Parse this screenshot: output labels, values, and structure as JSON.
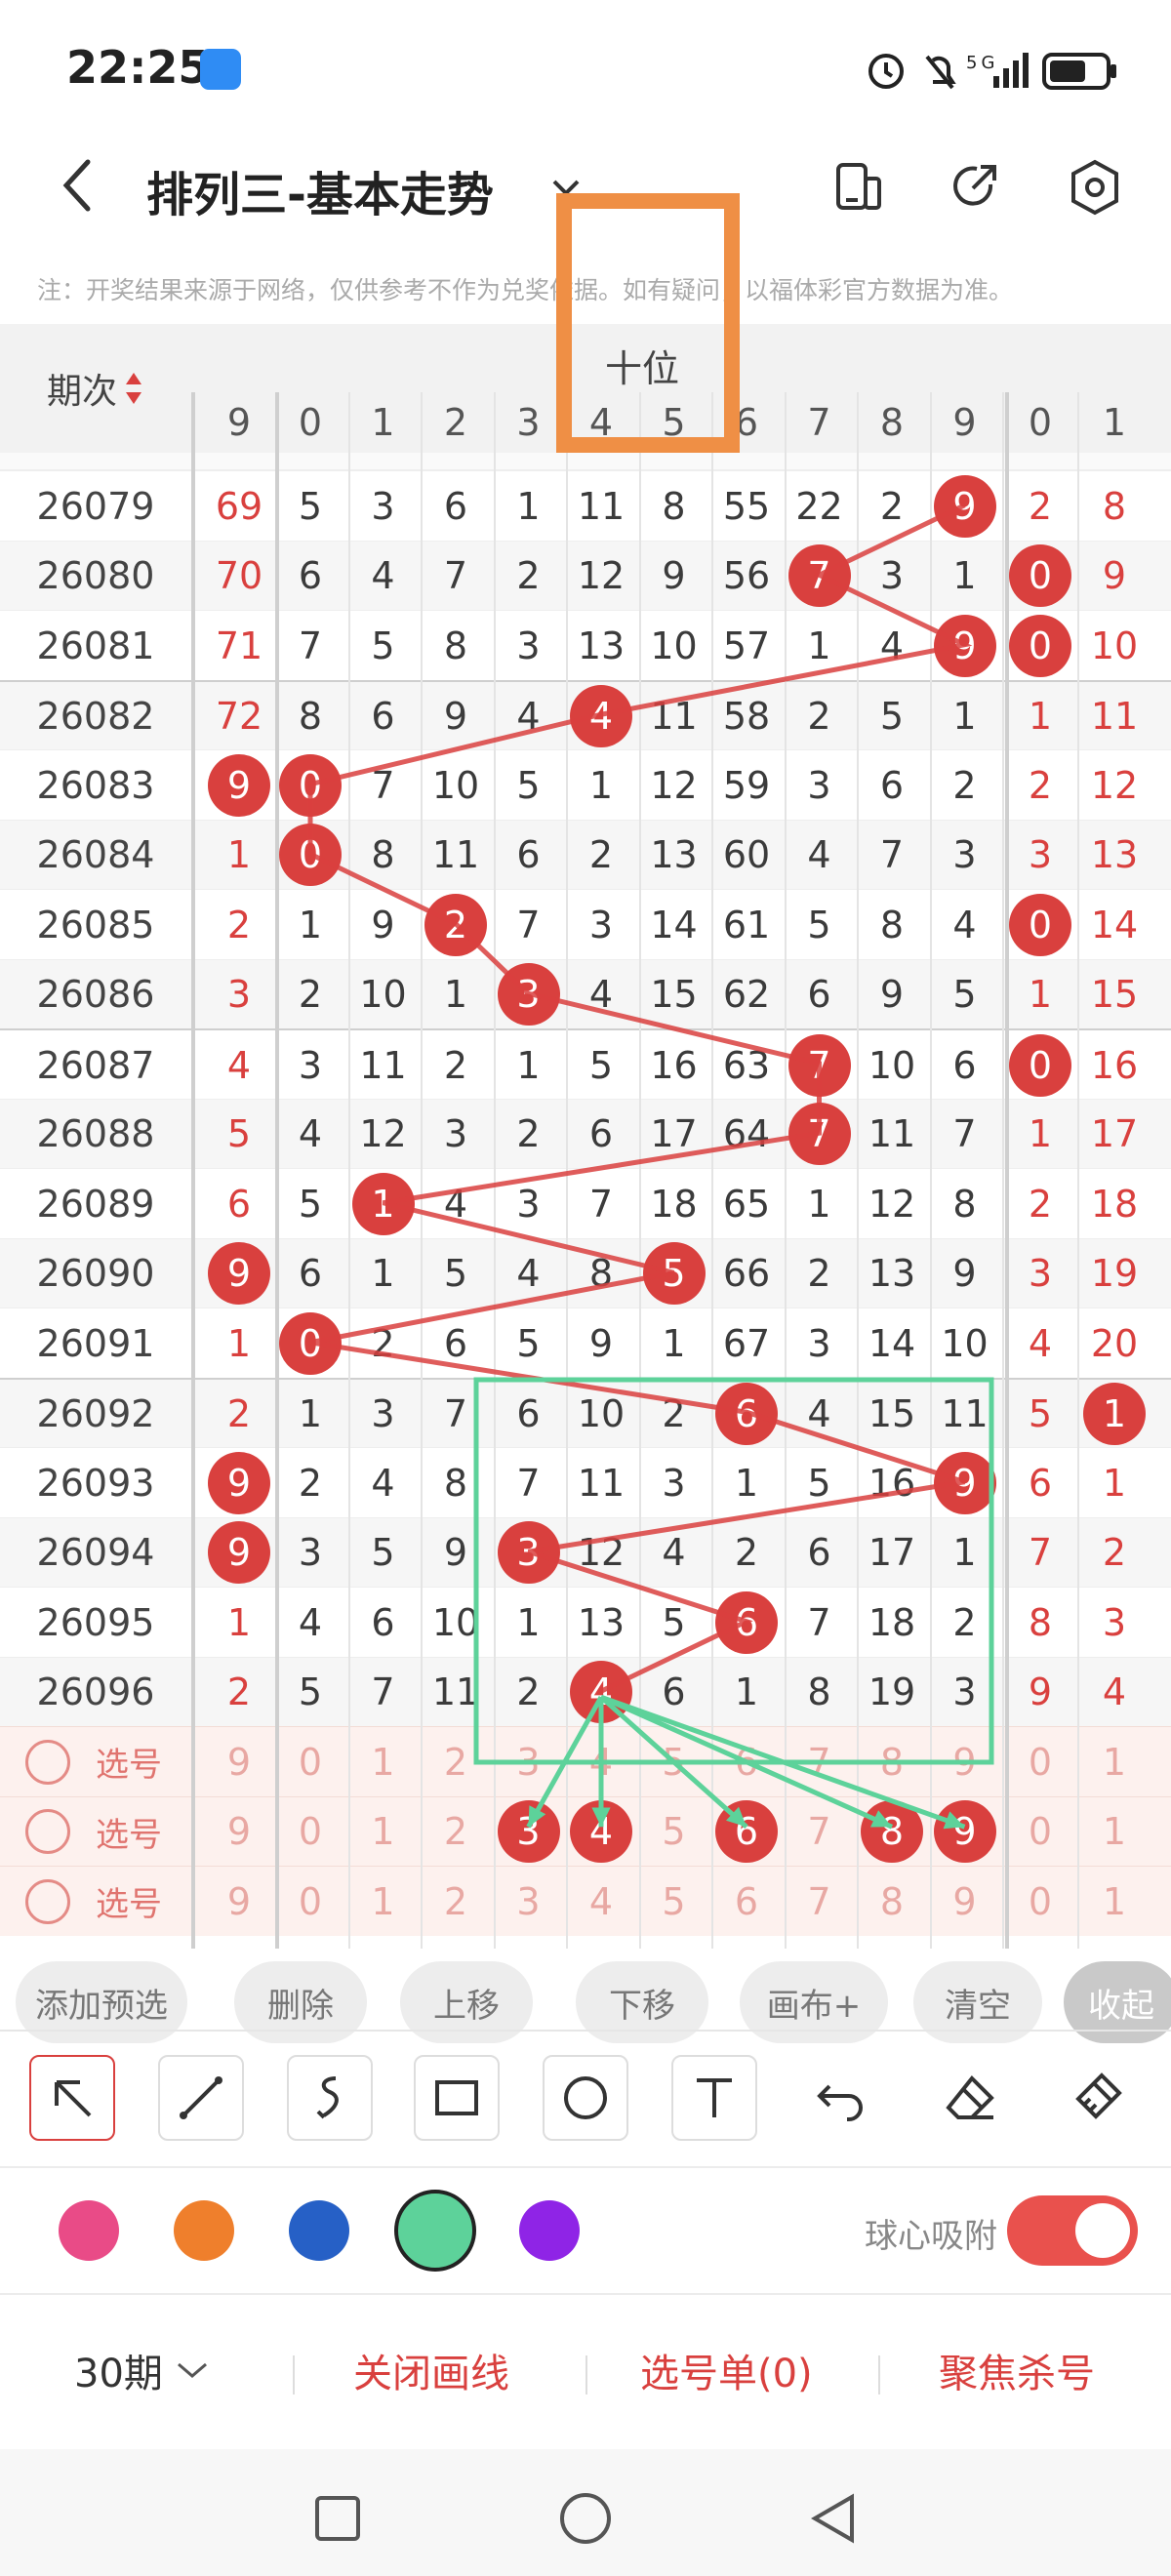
{
  "status": {
    "time": "22:25"
  },
  "header": {
    "title": "排列三-基本走势"
  },
  "note": "注：开奖结果来源于网络，仅供参考不作为兑奖依据。如有疑问，以福体彩官方数据为准。",
  "table": {
    "period_header": "期次",
    "group_label": "十位",
    "columns_prev": [
      "9"
    ],
    "columns_main": [
      "0",
      "1",
      "2",
      "3",
      "4",
      "5",
      "6",
      "7",
      "8",
      "9"
    ],
    "columns_next": [
      "0",
      "1"
    ],
    "rows": [
      {
        "period": "26079",
        "prev": "69",
        "main": [
          "5",
          "3",
          "6",
          "1",
          "11",
          "8",
          "55",
          "22",
          "2",
          "9"
        ],
        "next": [
          "2",
          "8"
        ],
        "ball_main": 9
      },
      {
        "period": "26080",
        "prev": "70",
        "main": [
          "6",
          "4",
          "7",
          "2",
          "12",
          "9",
          "56",
          "7",
          "3",
          "1"
        ],
        "next": [
          "0",
          "9"
        ],
        "ball_main": 7,
        "ball_next": 0
      },
      {
        "period": "26081",
        "prev": "71",
        "main": [
          "7",
          "5",
          "8",
          "3",
          "13",
          "10",
          "57",
          "1",
          "4",
          "9"
        ],
        "next": [
          "0",
          "10"
        ],
        "ball_main": 9,
        "ball_next": 0
      },
      {
        "period": "26082",
        "prev": "72",
        "main": [
          "8",
          "6",
          "9",
          "4",
          "4",
          "11",
          "58",
          "2",
          "5",
          "1"
        ],
        "next": [
          "1",
          "11"
        ],
        "ball_main": 4
      },
      {
        "period": "26083",
        "prev": "9",
        "main": [
          "0",
          "7",
          "10",
          "5",
          "1",
          "12",
          "59",
          "3",
          "6",
          "2"
        ],
        "next": [
          "2",
          "12"
        ],
        "ball_main": 0,
        "ball_prev": true
      },
      {
        "period": "26084",
        "prev": "1",
        "main": [
          "0",
          "8",
          "11",
          "6",
          "2",
          "13",
          "60",
          "4",
          "7",
          "3"
        ],
        "next": [
          "3",
          "13"
        ],
        "ball_main": 0
      },
      {
        "period": "26085",
        "prev": "2",
        "main": [
          "1",
          "9",
          "2",
          "7",
          "3",
          "14",
          "61",
          "5",
          "8",
          "4"
        ],
        "next": [
          "0",
          "14"
        ],
        "ball_main": 2,
        "ball_next": 0
      },
      {
        "period": "26086",
        "prev": "3",
        "main": [
          "2",
          "10",
          "1",
          "3",
          "4",
          "15",
          "62",
          "6",
          "9",
          "5"
        ],
        "next": [
          "1",
          "15"
        ],
        "ball_main": 3
      },
      {
        "period": "26087",
        "prev": "4",
        "main": [
          "3",
          "11",
          "2",
          "1",
          "5",
          "16",
          "63",
          "7",
          "10",
          "6"
        ],
        "next": [
          "0",
          "16"
        ],
        "ball_main": 7,
        "ball_next": 0
      },
      {
        "period": "26088",
        "prev": "5",
        "main": [
          "4",
          "12",
          "3",
          "2",
          "6",
          "17",
          "64",
          "7",
          "11",
          "7"
        ],
        "next": [
          "1",
          "17"
        ],
        "ball_main": 7
      },
      {
        "period": "26089",
        "prev": "6",
        "main": [
          "5",
          "1",
          "4",
          "3",
          "7",
          "18",
          "65",
          "1",
          "12",
          "8"
        ],
        "next": [
          "2",
          "18"
        ],
        "ball_main": 1
      },
      {
        "period": "26090",
        "prev": "9",
        "main": [
          "6",
          "1",
          "5",
          "4",
          "8",
          "5",
          "66",
          "2",
          "13",
          "9"
        ],
        "next": [
          "3",
          "19"
        ],
        "ball_main": 5,
        "ball_prev": true
      },
      {
        "period": "26091",
        "prev": "1",
        "main": [
          "0",
          "2",
          "6",
          "5",
          "9",
          "1",
          "67",
          "3",
          "14",
          "10"
        ],
        "next": [
          "4",
          "20"
        ],
        "ball_main": 0
      },
      {
        "period": "26092",
        "prev": "2",
        "main": [
          "1",
          "3",
          "7",
          "6",
          "10",
          "2",
          "6",
          "4",
          "15",
          "11"
        ],
        "next": [
          "5",
          "1"
        ],
        "ball_main": 6,
        "ball_next": 1
      },
      {
        "period": "26093",
        "prev": "9",
        "main": [
          "2",
          "4",
          "8",
          "7",
          "11",
          "3",
          "1",
          "5",
          "16",
          "9"
        ],
        "next": [
          "6",
          "1"
        ],
        "ball_main": 9,
        "ball_prev": true
      },
      {
        "period": "26094",
        "prev": "9",
        "main": [
          "3",
          "5",
          "9",
          "3",
          "12",
          "4",
          "2",
          "6",
          "17",
          "1"
        ],
        "next": [
          "7",
          "2"
        ],
        "ball_main": 3,
        "ball_prev": true
      },
      {
        "period": "26095",
        "prev": "1",
        "main": [
          "4",
          "6",
          "10",
          "1",
          "13",
          "5",
          "6",
          "7",
          "18",
          "2"
        ],
        "next": [
          "8",
          "3"
        ],
        "ball_main": 6
      },
      {
        "period": "26096",
        "prev": "2",
        "main": [
          "5",
          "7",
          "11",
          "2",
          "4",
          "6",
          "1",
          "8",
          "19",
          "3"
        ],
        "next": [
          "9",
          "4"
        ],
        "ball_main": 4
      }
    ],
    "pick_label": "选号",
    "pick_rows": [
      {
        "prev": "9",
        "main": [
          "0",
          "1",
          "2",
          "3",
          "4",
          "5",
          "6",
          "7",
          "8",
          "9"
        ],
        "next": [
          "0",
          "1"
        ],
        "balls": []
      },
      {
        "prev": "9",
        "main": [
          "0",
          "1",
          "2",
          "3",
          "4",
          "5",
          "6",
          "7",
          "8",
          "9"
        ],
        "next": [
          "0",
          "1"
        ],
        "balls": [
          3,
          4,
          6,
          8,
          9
        ]
      },
      {
        "prev": "9",
        "main": [
          "0",
          "1",
          "2",
          "3",
          "4",
          "5",
          "6",
          "7",
          "8",
          "9"
        ],
        "next": [
          "0",
          "1"
        ],
        "balls": []
      }
    ]
  },
  "toolbar": {
    "buttons": [
      "添加预选",
      "删除",
      "上移",
      "下移",
      "画布+",
      "清空",
      "收起"
    ]
  },
  "colors": {
    "palette": [
      "#e94b87",
      "#ef7f2c",
      "#2660c6",
      "#5dd29a",
      "#8f24e6"
    ],
    "selected": "#5dd29a",
    "accent": "#d9403e"
  },
  "snap": {
    "label": "球心吸附",
    "on": true
  },
  "bottom": {
    "periods": "30期",
    "close_draw": "关闭画线",
    "pick_list": "选号单(0)",
    "focus": "聚焦杀号"
  }
}
